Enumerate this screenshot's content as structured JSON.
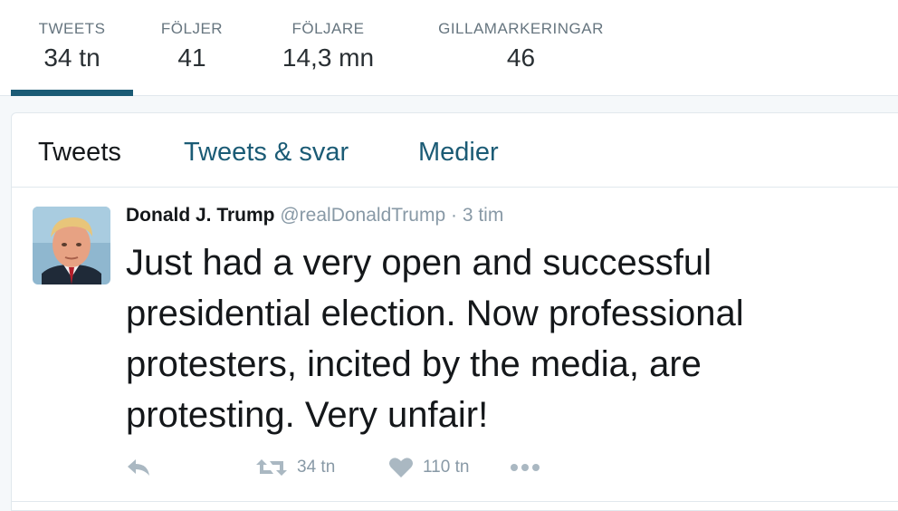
{
  "profile_nav": {
    "stats": [
      {
        "label": "TWEETS",
        "value": "34 tn"
      },
      {
        "label": "FÖLJER",
        "value": "41"
      },
      {
        "label": "FÖLJARE",
        "value": "14,3 mn"
      },
      {
        "label": "GILLAMARKERINGAR",
        "value": "46"
      }
    ],
    "active_stat": "TWEETS"
  },
  "timeline": {
    "tabs": [
      {
        "label": "Tweets"
      },
      {
        "label": "Tweets & svar"
      },
      {
        "label": "Medier"
      }
    ],
    "active_tab": "Tweets",
    "tweet": {
      "fullname": "Donald J. Trump",
      "username": "@realDonaldTrump",
      "separator": "·",
      "time": "3 tim",
      "text": "Just had a very open and successful presidential election. Now professional protesters, incited by the media, are protesting. Very unfair!",
      "actions": {
        "reply_icon": "reply-icon",
        "retweet_icon": "retweet-icon",
        "retweet_count": "34 tn",
        "like_icon": "heart-icon",
        "like_count": "110 tn",
        "more_icon": "more-dots-icon"
      }
    }
  },
  "colors": {
    "accent": "#1b5b75",
    "text": "#14171a",
    "muted": "#8899a6",
    "icon": "#aab8c2",
    "border": "#e1e8ed",
    "background": "#f5f8fa"
  }
}
